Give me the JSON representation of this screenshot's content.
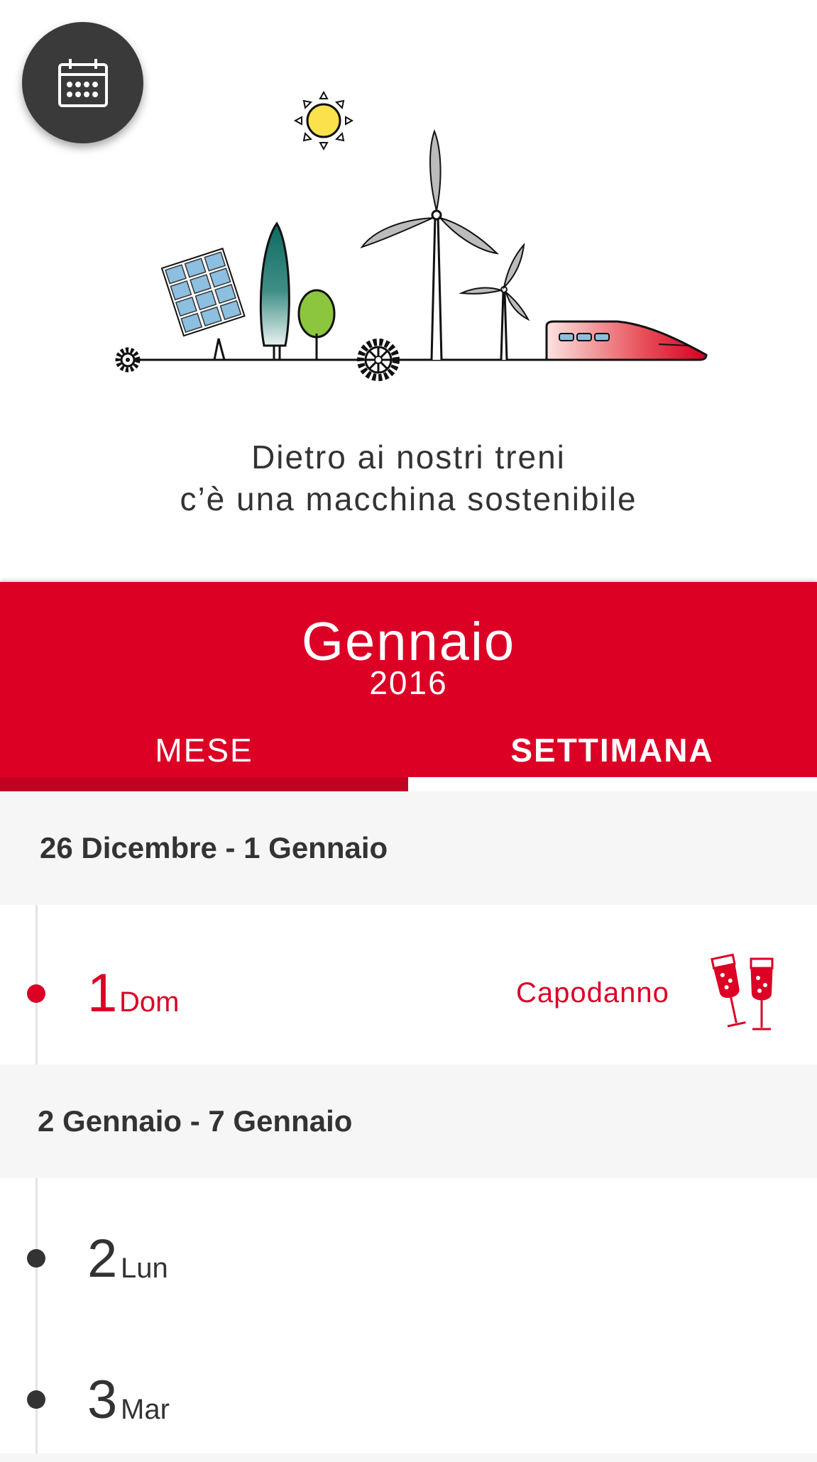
{
  "hero": {
    "tagline_line1": "Dietro ai nostri treni",
    "tagline_line2": "c’è una macchina sostenibile",
    "calendar_button_icon": "calendar-icon"
  },
  "header": {
    "month": "Gennaio",
    "year": "2016",
    "tabs": [
      {
        "label": "MESE",
        "active": false
      },
      {
        "label": "SETTIMANA",
        "active": true
      }
    ]
  },
  "weeks": [
    {
      "range": "26 Dicembre - 1 Gennaio",
      "days": [
        {
          "number": "1",
          "name": "Dom",
          "event": "Capodanno",
          "event_icon": "champagne-glasses-icon",
          "holiday": true
        }
      ]
    },
    {
      "range": "2 Gennaio - 7 Gennaio",
      "days": [
        {
          "number": "2",
          "name": "Lun",
          "event": "",
          "holiday": false
        },
        {
          "number": "3",
          "name": "Mar",
          "event": "",
          "holiday": false
        }
      ]
    }
  ],
  "colors": {
    "brand_red": "#dc0025",
    "text_dark": "#333333",
    "background": "#f6f6f6"
  }
}
